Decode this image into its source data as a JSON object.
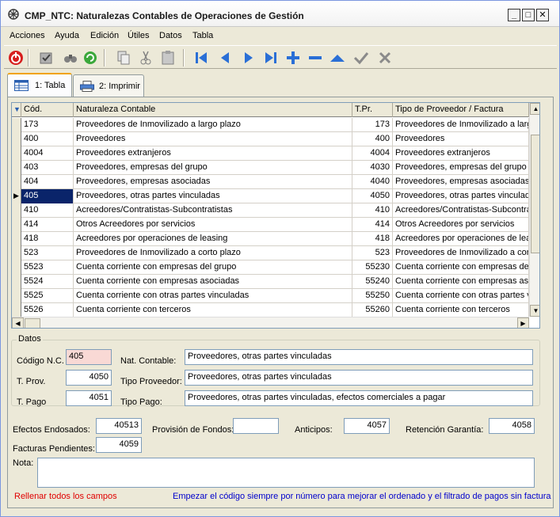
{
  "window": {
    "title": "CMP_NTC: Naturalezas Contables de Operaciones de Gestión"
  },
  "menu": [
    "Acciones",
    "Ayuda",
    "Edición",
    "Útiles",
    "Datos",
    "Tabla"
  ],
  "tabs": [
    {
      "label": "1: Tabla"
    },
    {
      "label": "2: Imprimir"
    }
  ],
  "grid": {
    "headers": {
      "cod": "Cód.",
      "nat": "Naturaleza Contable",
      "tpr": "T.Pr.",
      "tipo": "Tipo de Proveedor / Factura"
    },
    "rows": [
      {
        "cod": "173",
        "nat": "Proveedores de Inmovilizado a largo plazo",
        "tpr": "173",
        "tipo": "Proveedores de Inmovilizado a largo plazo"
      },
      {
        "cod": "400",
        "nat": "Proveedores",
        "tpr": "400",
        "tipo": "Proveedores"
      },
      {
        "cod": "4004",
        "nat": "Proveedores extranjeros",
        "tpr": "4004",
        "tipo": "Proveedores extranjeros"
      },
      {
        "cod": "403",
        "nat": "Proveedores, empresas del grupo",
        "tpr": "4030",
        "tipo": "Proveedores, empresas del grupo"
      },
      {
        "cod": "404",
        "nat": "Proveedores, empresas asociadas",
        "tpr": "4040",
        "tipo": "Proveedores, empresas asociadas"
      },
      {
        "cod": "405",
        "nat": "Proveedores, otras partes vinculadas",
        "tpr": "4050",
        "tipo": "Proveedores, otras partes vinculadas"
      },
      {
        "cod": "410",
        "nat": "Acreedores/Contratistas-Subcontratistas",
        "tpr": "410",
        "tipo": "Acreedores/Contratistas-Subcontratistas"
      },
      {
        "cod": "414",
        "nat": "Otros Acreedores por servicios",
        "tpr": "414",
        "tipo": "Otros Acreedores por servicios"
      },
      {
        "cod": "418",
        "nat": "Acreedores por operaciones de leasing",
        "tpr": "418",
        "tipo": "Acreedores por operaciones de leasing"
      },
      {
        "cod": "523",
        "nat": "Proveedores de Inmovilizado a corto plazo",
        "tpr": "523",
        "tipo": "Proveedores de Inmovilizado a corto plazo"
      },
      {
        "cod": "5523",
        "nat": "Cuenta corriente con empresas del grupo",
        "tpr": "55230",
        "tipo": "Cuenta corriente con empresas del grupo"
      },
      {
        "cod": "5524",
        "nat": "Cuenta corriente con empresas asociadas",
        "tpr": "55240",
        "tipo": "Cuenta corriente con empresas asociadas"
      },
      {
        "cod": "5525",
        "nat": "Cuenta corriente con otras partes vinculadas",
        "tpr": "55250",
        "tipo": "Cuenta corriente con otras partes vinculadas"
      },
      {
        "cod": "5526",
        "nat": "Cuenta corriente con terceros",
        "tpr": "55260",
        "tipo": "Cuenta corriente con terceros"
      }
    ],
    "selected_index": 5
  },
  "datos": {
    "group_title": "Datos",
    "codigo_label": "Código N.C.",
    "codigo_value": "405",
    "nat_label": "Nat. Contable:",
    "nat_value": "Proveedores, otras partes vinculadas",
    "tprov_label": "T. Prov.",
    "tprov_value": "4050",
    "tipoprov_label": "Tipo Proveedor:",
    "tipoprov_value": "Proveedores, otras partes vinculadas",
    "tpago_label": "T. Pago",
    "tpago_value": "4051",
    "tipopago_label": "Tipo Pago:",
    "tipopago_value": "Proveedores, otras partes vinculadas, efectos comerciales a pagar"
  },
  "extra": {
    "efectos_label": "Efectos Endosados:",
    "efectos_value": "40513",
    "provision_label": "Provisión de Fondos:",
    "provision_value": "",
    "anticipos_label": "Anticipos:",
    "anticipos_value": "4057",
    "retencion_label": "Retención Garantía:",
    "retencion_value": "4058",
    "facturas_label": "Facturas Pendientes:",
    "facturas_value": "4059",
    "nota_label": "Nota:",
    "nota_value": ""
  },
  "hints": {
    "left": "Rellenar todos los campos",
    "right": "Empezar el código siempre por número para mejorar el ordenado y el filtrado de pagos sin factura"
  },
  "colors": {
    "hint_red": "#e00000",
    "hint_blue": "#0000cc",
    "selection": "#0a246a",
    "required_field": "#f9d9d5"
  }
}
